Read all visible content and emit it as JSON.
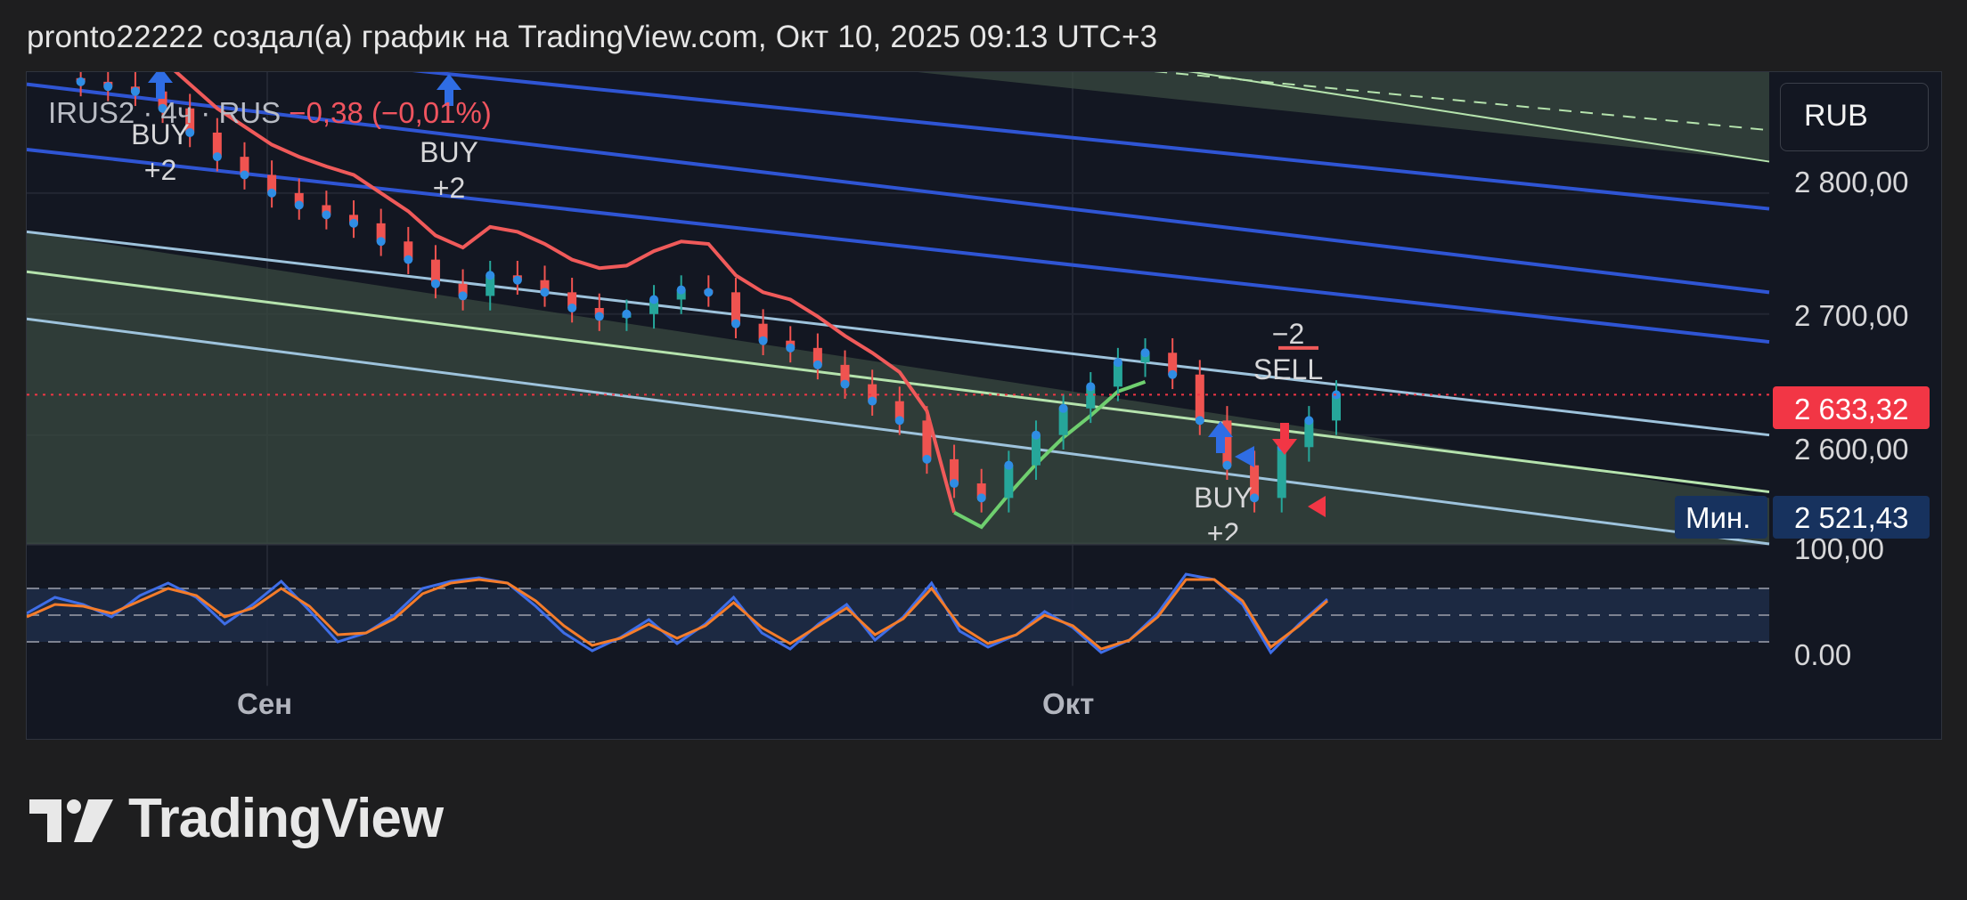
{
  "header": "pronto22222 создал(а) график на TradingView.com, Окт 10, 2025 09:13 UTC+3",
  "symbol": {
    "ticker": "IRUS2",
    "interval": "4ч",
    "exchange": "RUS",
    "change": "−0,38 (−0,01%)",
    "separator": "·"
  },
  "currency_button": "RUB",
  "price_axis": {
    "ticks": [
      "2 800,00",
      "2 700,00",
      "2 600,00"
    ],
    "last_price": "2 633,32",
    "min_label": "Мин.",
    "min_price": "2 521,43"
  },
  "oscillator_axis": {
    "ticks": [
      "100,00",
      "0.00"
    ]
  },
  "time_axis": {
    "labels": [
      "Сен",
      "Окт"
    ]
  },
  "signals": [
    {
      "label": "BUY",
      "qty": "+2"
    },
    {
      "label": "BUY",
      "qty": "+2"
    },
    {
      "label": "SELL",
      "qty": "−2"
    },
    {
      "label": "BUY",
      "qty": "+2"
    }
  ],
  "brand": "TradingView",
  "colors": {
    "background": "#131722",
    "channel_blue": "#2f55d4",
    "channel_light": "#9ec3dc",
    "channel_green": "#b5e3ad",
    "supertrend_red": "#f05a5a",
    "supertrend_green": "#6fcf6f",
    "candle_blue": "#2f8de4",
    "candle_green": "#26a69a",
    "candle_red": "#ef5350",
    "stoch_k": "#3f6ee8",
    "stoch_d": "#f57c2a",
    "last_price_badge": "#f23645",
    "min_badge": "#17325e"
  },
  "chart_data": {
    "type": "line",
    "title": "",
    "ylabel": "",
    "xlabel": "",
    "ylim": [
      2510,
      2900
    ],
    "x_labels": [
      "Сен",
      "Окт"
    ],
    "series": [
      {
        "values": [
          2895,
          2892,
          2888,
          2884,
          2870,
          2850,
          2830,
          2815,
          2800,
          2790,
          2782,
          2775,
          2760,
          2745,
          2725,
          2715,
          2732,
          2728,
          2718,
          2705,
          2698,
          2700,
          2712,
          2720,
          2718,
          2692,
          2678,
          2672,
          2658,
          2642,
          2628,
          2612,
          2580,
          2560,
          2548,
          2575,
          2600,
          2622,
          2640,
          2660,
          2668,
          2650,
          2612,
          2575,
          2548,
          2590,
          2612,
          2633.32
        ]
      }
    ],
    "oscillator": {
      "ylim": [
        0,
        100
      ],
      "k": [
        52,
        70,
        62,
        48,
        72,
        86,
        70,
        40,
        62,
        88,
        55,
        20,
        30,
        50,
        80,
        88,
        92,
        86,
        60,
        30,
        10,
        25,
        45,
        18,
        40,
        70,
        30,
        12,
        40,
        62,
        22,
        48,
        86,
        32,
        14,
        28,
        54,
        36,
        8,
        22,
        52,
        96,
        90,
        62,
        8,
        40,
        68
      ],
      "d": [
        48,
        62,
        60,
        52,
        66,
        80,
        72,
        48,
        58,
        80,
        60,
        28,
        30,
        46,
        74,
        86,
        90,
        86,
        66,
        38,
        16,
        24,
        40,
        24,
        38,
        64,
        36,
        18,
        38,
        58,
        28,
        46,
        80,
        38,
        18,
        28,
        50,
        38,
        12,
        22,
        48,
        90,
        90,
        66,
        14,
        38,
        66
      ],
      "levels": [
        80,
        50,
        20
      ]
    }
  }
}
